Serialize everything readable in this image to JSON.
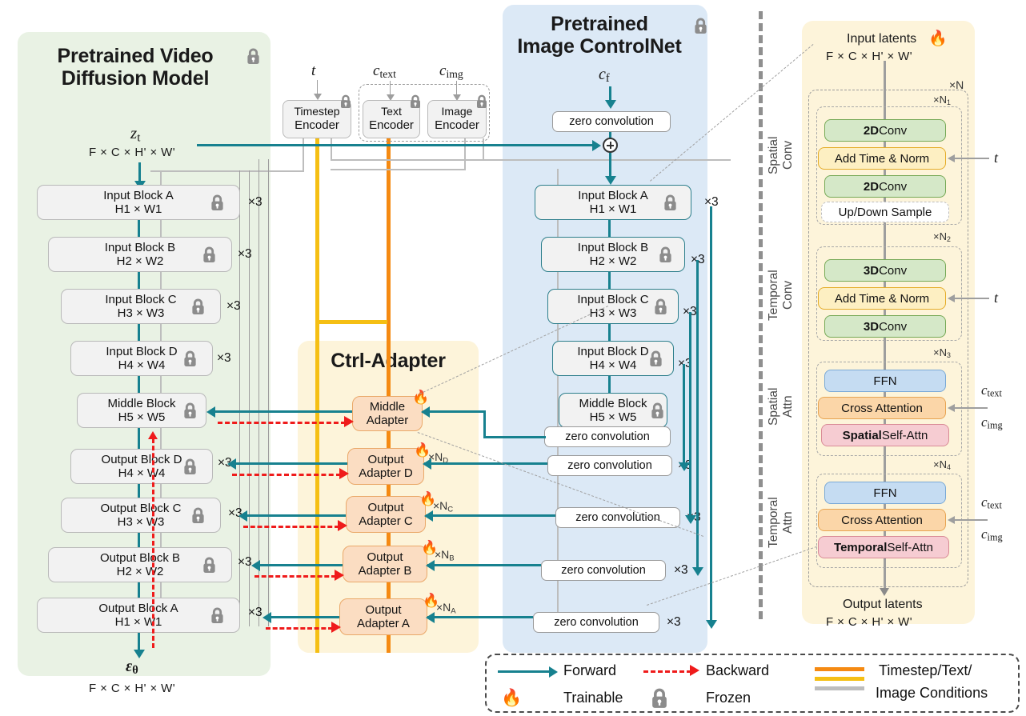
{
  "panels": {
    "video": {
      "title_line1": "Pretrained Video",
      "title_line2": "Diffusion Model",
      "input_symbol": "z",
      "input_sub": "t",
      "input_dims": "F × C × H' × W'",
      "output_symbol": "ε",
      "output_sub": "θ",
      "output_dims": "F × C × H' × W'",
      "blocks": [
        {
          "name": "Input Block A",
          "dims": "H1 × W1",
          "repeat": "×3"
        },
        {
          "name": "Input Block B",
          "dims": "H2 × W2",
          "repeat": "×3"
        },
        {
          "name": "Input Block C",
          "dims": "H3 × W3",
          "repeat": "×3"
        },
        {
          "name": "Input Block D",
          "dims": "H4 × W4",
          "repeat": "×3"
        },
        {
          "name": "Middle Block",
          "dims": "H5 × W5",
          "repeat": ""
        },
        {
          "name": "Output Block D",
          "dims": "H4 × W4",
          "repeat": "×3"
        },
        {
          "name": "Output Block C",
          "dims": "H3 × W3",
          "repeat": "×3"
        },
        {
          "name": "Output Block B",
          "dims": "H2 × W2",
          "repeat": "×3"
        },
        {
          "name": "Output Block A",
          "dims": "H1 × W1",
          "repeat": "×3"
        }
      ]
    },
    "controlnet": {
      "title_line1": "Pretrained",
      "title_line2": "Image ControlNet",
      "input_symbol": "c",
      "input_sub": "f",
      "blocks": [
        {
          "name": "Input Block A",
          "dims": "H1 × W1",
          "repeat": "×3"
        },
        {
          "name": "Input Block B",
          "dims": "H2 × W2",
          "repeat": "×3"
        },
        {
          "name": "Input Block C",
          "dims": "H3 × W3",
          "repeat": "×3"
        },
        {
          "name": "Input Block D",
          "dims": "H4 × W4",
          "repeat": "×3"
        },
        {
          "name": "Middle Block",
          "dims": "H5 × W5",
          "repeat": ""
        }
      ],
      "zero_conv_label": "zero convolution",
      "zero_convs": [
        {
          "label": "zero convolution",
          "repeat": ""
        },
        {
          "label": "zero convolution",
          "repeat": ""
        },
        {
          "label": "zero convolution",
          "repeat": "×3"
        },
        {
          "label": "zero convolution",
          "repeat": "×3"
        },
        {
          "label": "zero convolution",
          "repeat": "×3"
        },
        {
          "label": "zero convolution",
          "repeat": "×3"
        }
      ]
    },
    "adapter": {
      "title": "Ctrl-Adapter",
      "items": [
        {
          "line1": "Middle",
          "line2": "Adapter",
          "repeat": ""
        },
        {
          "line1": "Output",
          "line2": "Adapter D",
          "repeat": "×N",
          "repeat_sub": "D"
        },
        {
          "line1": "Output",
          "line2": "Adapter C",
          "repeat": "×N",
          "repeat_sub": "C"
        },
        {
          "line1": "Output",
          "line2": "Adapter B",
          "repeat": "×N",
          "repeat_sub": "B"
        },
        {
          "line1": "Output",
          "line2": "Adapter A",
          "repeat": "×N",
          "repeat_sub": "A"
        }
      ]
    },
    "detail": {
      "input_title": "Input latents",
      "input_dims": "F × C × H' × W'",
      "output_title": "Output latents",
      "output_dims": "F × C × H' × W'",
      "repeat_outer": "×N",
      "groups": [
        {
          "side_label": "Spatial\nConv",
          "repeat": "×N",
          "repeat_sub": "1",
          "rows": [
            {
              "text": "2D Conv",
              "bold": "2D",
              "rest": " Conv",
              "style": "green"
            },
            {
              "text": "Add Time & Norm",
              "bold": "",
              "rest": "Add Time & Norm",
              "style": "yellow",
              "cond": "t"
            },
            {
              "text": "2D Conv",
              "bold": "2D",
              "rest": " Conv",
              "style": "green"
            },
            {
              "text": "Up/Down Sample",
              "bold": "",
              "rest": "Up/Down Sample",
              "style": "whiteb"
            }
          ]
        },
        {
          "side_label": "Temporal\nConv",
          "repeat": "×N",
          "repeat_sub": "2",
          "rows": [
            {
              "text": "3D Conv",
              "bold": "3D",
              "rest": " Conv",
              "style": "green"
            },
            {
              "text": "Add Time & Norm",
              "bold": "",
              "rest": "Add Time & Norm",
              "style": "yellow",
              "cond": "t"
            },
            {
              "text": "3D Conv",
              "bold": "3D",
              "rest": " Conv",
              "style": "green"
            }
          ]
        },
        {
          "side_label": "Spatial\nAttn",
          "repeat": "×N",
          "repeat_sub": "3",
          "rows": [
            {
              "text": "FFN",
              "bold": "",
              "rest": "FFN",
              "style": "blue"
            },
            {
              "text": "Cross Attention",
              "bold": "",
              "rest": "Cross Attention",
              "style": "orange",
              "cond2": true
            },
            {
              "text": "Spatial Self-Attn",
              "bold": "Spatial",
              "rest": " Self-Attn",
              "style": "pink"
            }
          ]
        },
        {
          "side_label": "Temporal\nAttn",
          "repeat": "×N",
          "repeat_sub": "4",
          "rows": [
            {
              "text": "FFN",
              "bold": "",
              "rest": "FFN",
              "style": "blue"
            },
            {
              "text": "Cross Attention",
              "bold": "",
              "rest": "Cross Attention",
              "style": "orange",
              "cond2": true
            },
            {
              "text": "Temporal Self-Attn",
              "bold": "Temporal",
              "rest": " Self-Attn",
              "style": "pink"
            }
          ]
        }
      ]
    }
  },
  "encoders": {
    "timestep": {
      "line1": "Timestep",
      "line2": "Encoder",
      "input": "t"
    },
    "text": {
      "line1": "Text",
      "line2": "Encoder",
      "input": "c",
      "input_sub": "text"
    },
    "image": {
      "line1": "Image",
      "line2": "Encoder",
      "input": "c",
      "input_sub": "img"
    }
  },
  "conditions": {
    "t": "t",
    "c_text_base": "c",
    "c_text_sub": "text",
    "c_img_base": "c",
    "c_img_sub": "img"
  },
  "legend": {
    "forward": "Forward",
    "backward": "Backward",
    "trainable": "Trainable",
    "frozen": "Frozen",
    "conditions_line1": "Timestep/Text/",
    "conditions_line2": "Image Conditions"
  },
  "colors": {
    "forward": "#17818f",
    "backward": "#ef1b1b",
    "timestep": "#f5bf14",
    "text_cond": "#f58a12",
    "image_cond": "#bdbdbd",
    "panel_video": "#e9f2e4",
    "panel_controlnet": "#dce9f6",
    "panel_adapter": "#fdf4da"
  },
  "icons": {
    "lock": "lock-icon",
    "flame": "flame-icon"
  }
}
